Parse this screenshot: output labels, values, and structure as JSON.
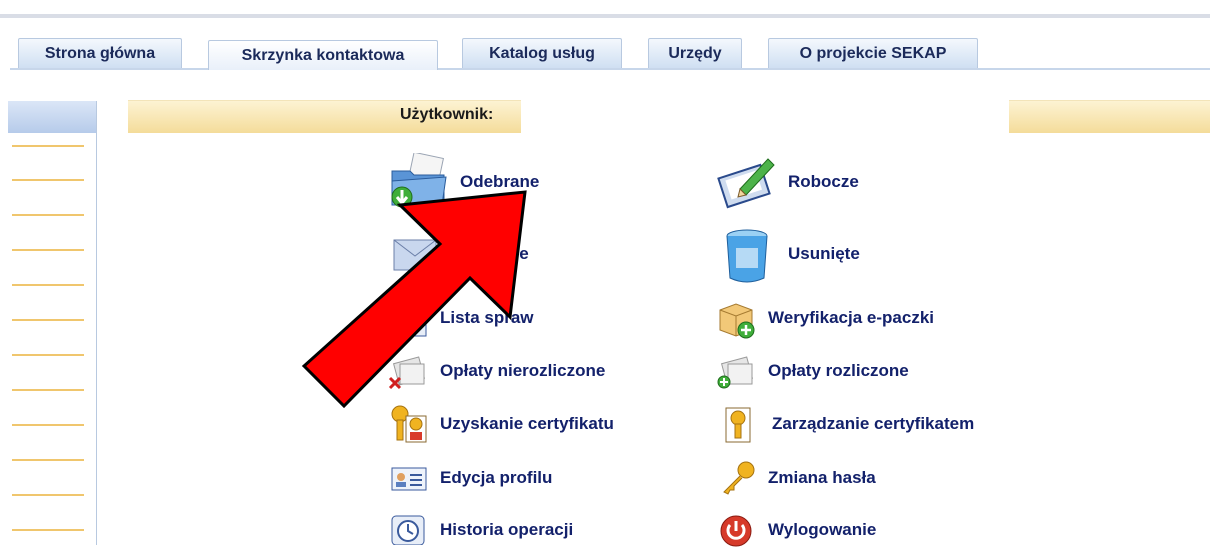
{
  "tabs": [
    {
      "label": "Strona główna"
    },
    {
      "label": "Skrzynka kontaktowa"
    },
    {
      "label": "Katalog usług"
    },
    {
      "label": "Urzędy"
    },
    {
      "label": "O projekcie SEKAP"
    }
  ],
  "user_bar": {
    "label": "Użytkownik:"
  },
  "menu": {
    "odebrane": "Odebrane",
    "robocze": "Robocze",
    "wyslane": "Wysłane",
    "usuniete": "Usunięte",
    "lista_spraw": "Lista spraw",
    "weryfikacja": "Weryfikacja e-paczki",
    "oplaty_nierozliczone": "Opłaty nierozliczone",
    "oplaty_rozliczone": "Opłaty rozliczone",
    "uzyskanie_certyfikatu": "Uzyskanie certyfikatu",
    "zarzadzanie_certyfikatem": "Zarządzanie certyfikatem",
    "edycja_profilu": "Edycja profilu",
    "zmiana_hasla": "Zmiana hasła",
    "historia_operacji": "Historia operacji",
    "wylogowanie": "Wylogowanie"
  },
  "colors": {
    "tab_text": "#1b2a5a",
    "menu_text": "#13216b",
    "annotation_arrow": "#ff0000"
  }
}
